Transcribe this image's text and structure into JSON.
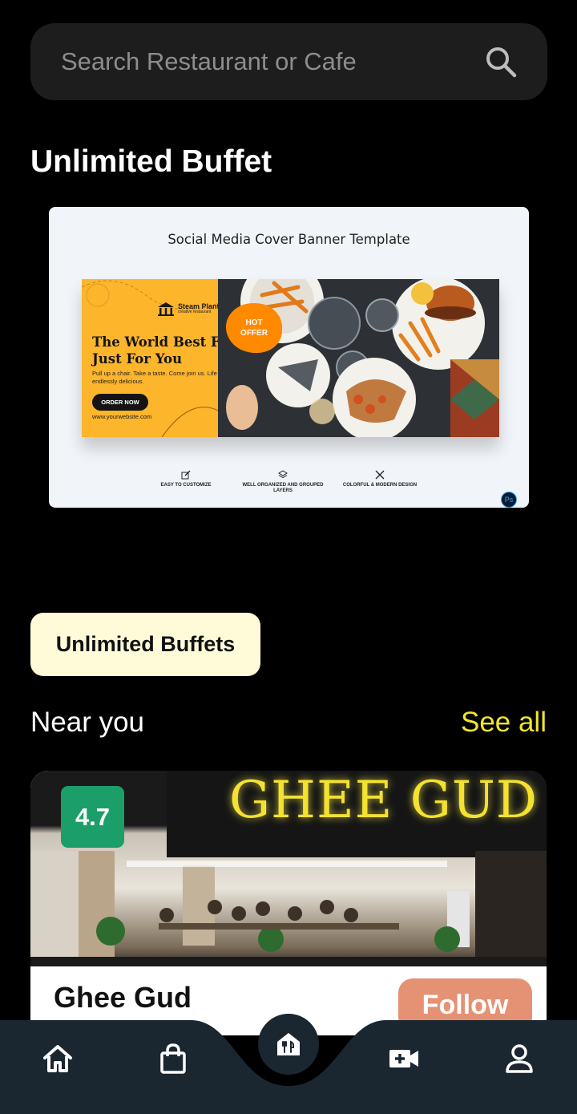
{
  "search": {
    "placeholder": "Search Restaurant or Cafe",
    "icon": "search-icon"
  },
  "section_title": "Unlimited Buffet",
  "banner": {
    "caption": "Social Media Cover Banner Template",
    "brand_name": "Steam Plant",
    "brand_sub": "creative restaurant",
    "headline": "The World Best Food Just For You",
    "subtext": "Pull up a chair. Take a taste. Come join us. Life is so endlessly delicious.",
    "cta": "ORDER NOW",
    "url": "www.yourwebsite.com",
    "badge_line1": "HOT",
    "badge_line2": "OFFER",
    "features": [
      "EASY TO CUSTOMIZE",
      "WELL ORGANIZED AND GROUPED LAYERS",
      "COLORFUL & MODERN DESIGN"
    ],
    "ps_badge": "Ps"
  },
  "chip_label": "Unlimited Buffets",
  "near": {
    "title": "Near you",
    "see_all": "See all"
  },
  "restaurant": {
    "rating": "4.7",
    "name": "Ghee Gud",
    "sign_text": "GHEE GUD",
    "follow_label": "Follow"
  },
  "nav": {
    "items": [
      "home-icon",
      "shopping-bag-icon",
      "dining-icon",
      "video-icon",
      "profile-icon"
    ],
    "active": "dining-icon"
  },
  "colors": {
    "background": "#000000",
    "search_bg": "#1d1d1d",
    "accent_yellow": "#f2e528",
    "chip_bg": "#fffbd8",
    "rating_green": "#1c9e68",
    "follow_bg": "#e59173",
    "nav_bg": "#1a2630"
  }
}
